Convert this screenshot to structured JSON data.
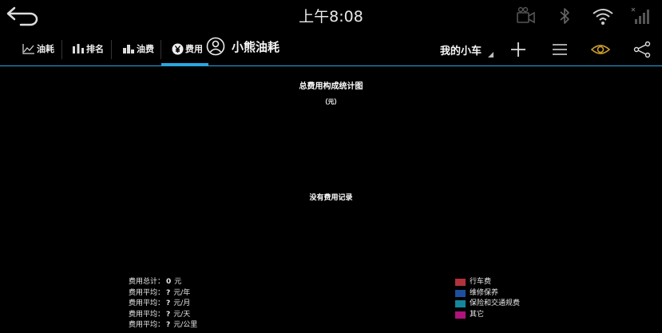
{
  "status": {
    "time": "上午8:08"
  },
  "nav": {
    "tabs": [
      {
        "label": "油耗",
        "icon": "line-chart-icon"
      },
      {
        "label": "排名",
        "icon": "ranking-icon"
      },
      {
        "label": "油费",
        "icon": "bar-chart-icon"
      },
      {
        "label": "费用",
        "icon": "yen-icon",
        "active": true
      }
    ],
    "app_title": "小熊油耗",
    "car_select": "我的小车",
    "accent_color": "#2aa6e0"
  },
  "chart": {
    "title": "总费用构成统计图",
    "unit": "（元）",
    "empty_message": "没有费用记录"
  },
  "stats": [
    {
      "label": "费用总计：",
      "value": "0",
      "unit": "元"
    },
    {
      "label": "费用平均：",
      "value": "?",
      "unit": "元/年"
    },
    {
      "label": "费用平均：",
      "value": "?",
      "unit": "元/月"
    },
    {
      "label": "费用平均：",
      "value": "?",
      "unit": "元/天"
    },
    {
      "label": "费用平均：",
      "value": "?",
      "unit": "元/公里"
    }
  ],
  "legend": [
    {
      "label": "行车费",
      "color": "#b0323c"
    },
    {
      "label": "维修保养",
      "color": "#1c4fa0"
    },
    {
      "label": "保险和交通规费",
      "color": "#15879a"
    },
    {
      "label": "其它",
      "color": "#b0147a"
    }
  ]
}
